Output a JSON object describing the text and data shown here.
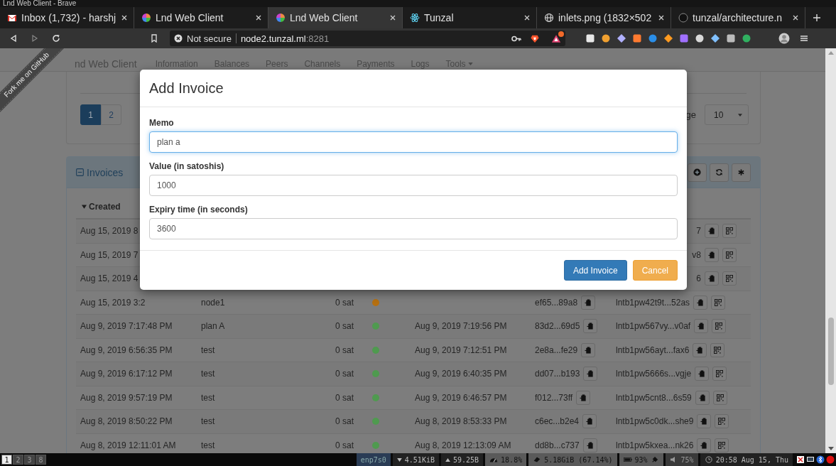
{
  "window": {
    "title": "Lnd Web Client - Brave"
  },
  "tabs": [
    {
      "label": "Inbox (1,732) - harshj",
      "kind": "mail",
      "selected": false
    },
    {
      "label": "Lnd Web Client",
      "kind": "wheel",
      "selected": false
    },
    {
      "label": "Lnd Web Client",
      "kind": "wheel",
      "selected": true
    },
    {
      "label": "Tunzal",
      "kind": "atom",
      "selected": false
    },
    {
      "label": "inlets.png (1832×502",
      "kind": "globe",
      "selected": false
    },
    {
      "label": "tunzal/architecture.n",
      "kind": "circle",
      "selected": false
    }
  ],
  "address_bar": {
    "security": "Not secure",
    "host": "node2.tunzal.ml",
    "port": ":8281"
  },
  "navbar": {
    "brand": "nd Web Client",
    "items": [
      "Information",
      "Balances",
      "Peers",
      "Channels",
      "Payments",
      "Logs",
      "Tools"
    ]
  },
  "ribbon": "Fork me on GitHub",
  "pagination": [
    {
      "label": "1",
      "selected": true
    },
    {
      "label": "2",
      "selected": false
    }
  ],
  "page_size": {
    "label": "ge",
    "value": "10"
  },
  "invoices": {
    "title": "Invoices",
    "sort_column": "Created",
    "rows": [
      {
        "created": "Aug 15, 2019 8",
        "payment_request": "7"
      },
      {
        "created": "Aug 15, 2019 7",
        "payment_request": "v8"
      },
      {
        "created": "Aug 15, 2019 4",
        "payment_request": "6"
      },
      {
        "created": "Aug 15, 2019 3:2",
        "memo": "node1",
        "value": "0 sat",
        "color": "#b56f10",
        "r_hash": "ef65...89a8",
        "payment_request": "lntb1pw42t9t...52as"
      },
      {
        "created": "Aug 9, 2019 7:17:48 PM",
        "memo": "plan A",
        "value": "0 sat",
        "color": "#4f9a4f",
        "settled": "Aug 9, 2019 7:19:56 PM",
        "r_hash": "83d2...69d5",
        "payment_request": "lntb1pw567vy...v0af"
      },
      {
        "created": "Aug 9, 2019 6:56:35 PM",
        "memo": "test",
        "value": "0 sat",
        "color": "#4f9a4f",
        "settled": "Aug 9, 2019 7:12:51 PM",
        "r_hash": "2e8a...fe29",
        "payment_request": "lntb1pw56ayt...fax6"
      },
      {
        "created": "Aug 9, 2019 6:17:12 PM",
        "memo": "test",
        "value": "0 sat",
        "color": "#4f9a4f",
        "settled": "Aug 9, 2019 6:40:35 PM",
        "r_hash": "dd07...b193",
        "payment_request": "lntb1pw5666s...vgje"
      },
      {
        "created": "Aug 8, 2019 9:57:19 PM",
        "memo": "test",
        "value": "0 sat",
        "color": "#4f9a4f",
        "settled": "Aug 9, 2019 6:46:57 PM",
        "r_hash": "f012...73ff",
        "payment_request": "lntb1pw5cnt8...6s59"
      },
      {
        "created": "Aug 8, 2019 8:50:22 PM",
        "memo": "test",
        "value": "0 sat",
        "color": "#4f9a4f",
        "settled": "Aug 8, 2019 8:53:33 PM",
        "r_hash": "c6ec...b2e4",
        "payment_request": "lntb1pw5c0dk...she9"
      },
      {
        "created": "Aug 8, 2019 12:11:01 AM",
        "memo": "test",
        "value": "0 sat",
        "color": "#4f9a4f",
        "settled": "Aug 8, 2019 12:13:09 AM",
        "r_hash": "dd8b...c737",
        "payment_request": "lntb1pw5kxea...nk26"
      }
    ]
  },
  "modal": {
    "title": "Add Invoice",
    "fields": [
      {
        "label": "Memo",
        "value": "plan a",
        "focused": true
      },
      {
        "label": "Value (in satoshis)",
        "value": "1000",
        "focused": false
      },
      {
        "label": "Expiry time (in seconds)",
        "value": "3600",
        "focused": false
      }
    ],
    "buttons": [
      {
        "label": "Add Invoice",
        "kind": "primary"
      },
      {
        "label": "Cancel",
        "kind": "warning"
      }
    ]
  },
  "taskbar": {
    "workspaces": [
      {
        "label": "1",
        "selected": true
      },
      {
        "label": "2",
        "selected": false
      },
      {
        "label": "3",
        "selected": false
      },
      {
        "label": "8",
        "selected": false
      }
    ],
    "interface": "enp7s0",
    "down": "4.51KiB",
    "up": "59.25B",
    "cpu": "18.8%",
    "memory": "5.18GiB (67.14%)",
    "battery": "93%",
    "volume": "75%",
    "clock": "20:58 Aug 15, Thu"
  }
}
